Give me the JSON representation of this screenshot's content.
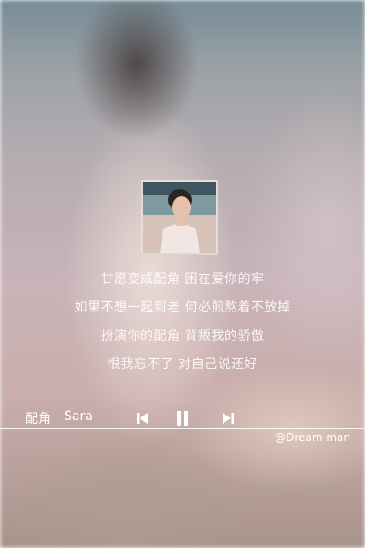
{
  "player": {
    "lyrics": [
      "甘愿变成配角 困在爱你的牢",
      "如果不想一起到老 何必煎熬着不放掉",
      "扮演你的配角 背叛我的骄傲",
      "恨我忘不了 对自己说还好"
    ],
    "song_title": "配角",
    "artist": "Sara",
    "credit": "@Dream man",
    "state": "playing"
  },
  "icons": {
    "prev": "skip-previous-icon",
    "pause": "pause-icon",
    "next": "skip-next-icon"
  },
  "colors": {
    "text": "#ffffff",
    "progress_line": "#ffffff"
  }
}
